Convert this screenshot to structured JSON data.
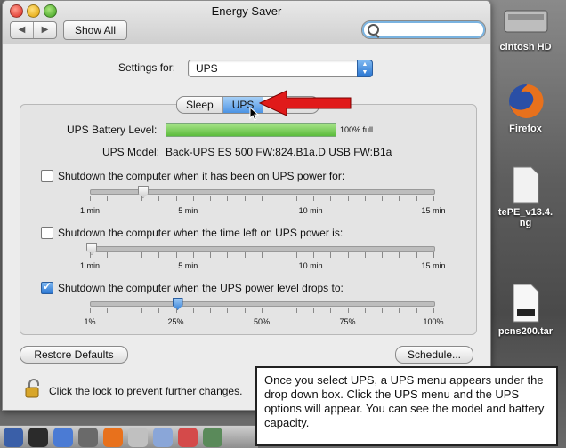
{
  "window": {
    "title": "Energy Saver",
    "show_all_label": "Show All",
    "search_placeholder": ""
  },
  "settings": {
    "label": "Settings for:",
    "selected": "UPS"
  },
  "tabs": [
    {
      "label": "Sleep",
      "active": false
    },
    {
      "label": "UPS",
      "active": true
    },
    {
      "label": "Options",
      "active": false
    }
  ],
  "ups": {
    "battery_label": "UPS Battery Level:",
    "battery_percent": 100,
    "battery_text": "100% full",
    "model_label": "UPS Model:",
    "model_value": "Back-UPS ES 500 FW:824.B1a.D USB FW:B1a"
  },
  "options": [
    {
      "label": "Shutdown the computer when it has been on UPS power for:",
      "checked": false,
      "ticks": [
        "1 min",
        "5 min",
        "10 min",
        "15 min"
      ],
      "value_fraction": 0.15
    },
    {
      "label": "Shutdown the computer when the time left on UPS power is:",
      "checked": false,
      "ticks": [
        "1 min",
        "5 min",
        "10 min",
        "15 min"
      ],
      "value_fraction": 0.0
    },
    {
      "label": "Shutdown the computer when the UPS power level drops to:",
      "checked": true,
      "ticks": [
        "1%",
        "25%",
        "50%",
        "75%",
        "100%"
      ],
      "value_fraction": 0.25
    }
  ],
  "buttons": {
    "restore": "Restore Defaults",
    "schedule": "Schedule..."
  },
  "lock_text": "Click the lock to prevent further changes.",
  "callout": "Once you select UPS, a UPS menu appears under the drop down box.  Click the UPS menu and the UPS options will appear.  You can see the model and battery capacity.",
  "desktop": {
    "items": [
      "cintosh HD",
      "Firefox",
      "tePE_v13.4.\nng",
      "pcns200.tar"
    ]
  },
  "colors": {
    "accent": "#3a84d8",
    "battery": "#5cbc3c",
    "arrow": "#e01a1a"
  }
}
